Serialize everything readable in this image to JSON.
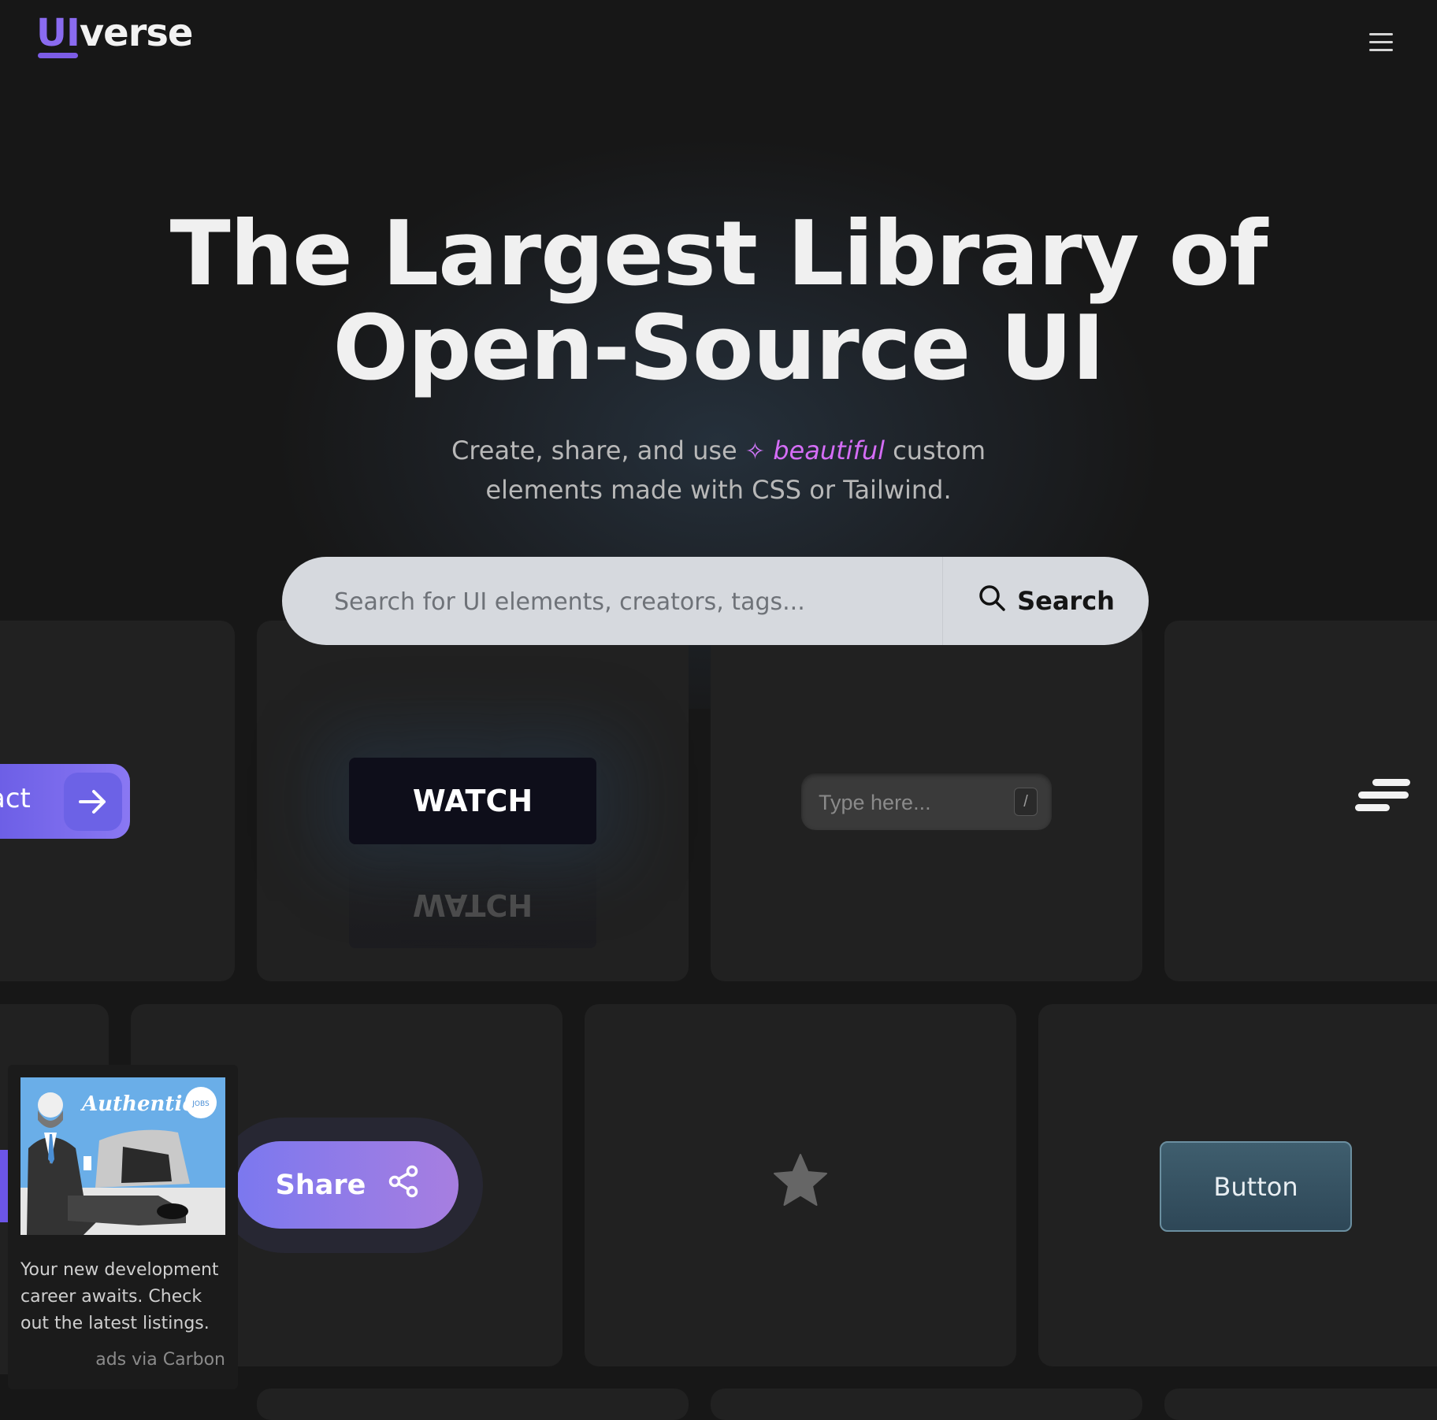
{
  "logo": {
    "part1": "UI",
    "part2": "verse"
  },
  "hero": {
    "title_line1": "The Largest Library of",
    "title_line2": "Open-Source UI",
    "sub_before": "Create, share, and use",
    "sub_highlight": "beautiful",
    "sub_after": "custom",
    "sub_line2": "elements made with CSS or Tailwind."
  },
  "search": {
    "placeholder": "Search for UI elements, creators, tags...",
    "button_label": "Search"
  },
  "cards": {
    "contact_label": "act",
    "watch_label": "WATCH",
    "watch_reflection": "WATCH",
    "type_placeholder": "Type here...",
    "slash_key": "/",
    "share_label": "Share",
    "button_label": "Button"
  },
  "ad": {
    "image_text": "Authentic",
    "image_badge": "JOBS",
    "text": "Your new development career awaits. Check out the latest listings.",
    "via": "ads via Carbon"
  },
  "colors": {
    "background": "#171717",
    "card": "#212121",
    "accent_purple": "#8a6bf0",
    "highlight_pink": "#d56df7",
    "search_bg": "#d6d9de"
  },
  "icons": [
    "menu-icon",
    "sparkle-icon",
    "search-icon",
    "arrow-right-icon",
    "slash-key",
    "lines-icon",
    "share-icon",
    "star-icon"
  ]
}
